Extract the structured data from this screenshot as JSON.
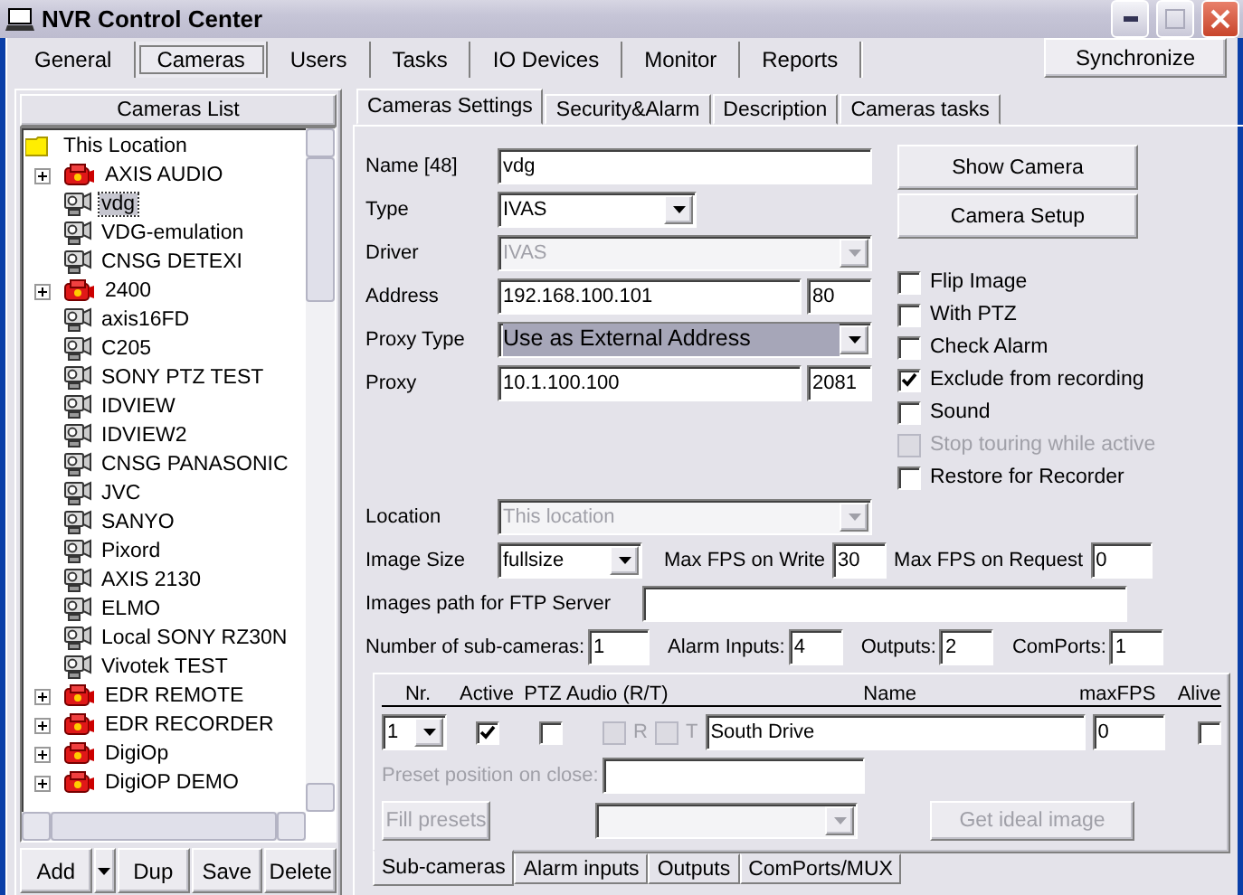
{
  "window": {
    "title": "NVR Control Center"
  },
  "main_tabs": [
    {
      "label": "General",
      "selected": false
    },
    {
      "label": "Cameras",
      "selected": true
    },
    {
      "label": "Users",
      "selected": false
    },
    {
      "label": "Tasks",
      "selected": false
    },
    {
      "label": "IO Devices",
      "selected": false
    },
    {
      "label": "Monitor",
      "selected": false
    },
    {
      "label": "Reports",
      "selected": false
    }
  ],
  "sync_button": "Synchronize",
  "cameras_list": {
    "title": "Cameras List",
    "root": {
      "label": "This Location",
      "selected": false,
      "children": [
        {
          "label": "AXIS AUDIO",
          "kind": "group",
          "selected": false
        },
        {
          "label": "vdg",
          "kind": "camera",
          "selected": true
        },
        {
          "label": "VDG-emulation",
          "kind": "camera",
          "selected": false
        },
        {
          "label": "CNSG DETEXI",
          "kind": "camera",
          "selected": false
        },
        {
          "label": "2400",
          "kind": "group",
          "selected": false
        },
        {
          "label": "axis16FD",
          "kind": "camera",
          "selected": false
        },
        {
          "label": "C205",
          "kind": "camera",
          "selected": false
        },
        {
          "label": "SONY PTZ TEST",
          "kind": "camera",
          "selected": false
        },
        {
          "label": "IDVIEW",
          "kind": "camera",
          "selected": false
        },
        {
          "label": "IDVIEW2",
          "kind": "camera",
          "selected": false
        },
        {
          "label": "CNSG PANASONIC",
          "kind": "camera",
          "selected": false
        },
        {
          "label": "JVC",
          "kind": "camera",
          "selected": false
        },
        {
          "label": "SANYO",
          "kind": "camera",
          "selected": false
        },
        {
          "label": "Pixord",
          "kind": "camera",
          "selected": false
        },
        {
          "label": "AXIS 2130",
          "kind": "camera",
          "selected": false
        },
        {
          "label": "ELMO",
          "kind": "camera",
          "selected": false
        },
        {
          "label": "Local SONY RZ30N",
          "kind": "camera",
          "selected": false
        },
        {
          "label": "Vivotek TEST",
          "kind": "camera",
          "selected": false
        },
        {
          "label": "EDR REMOTE",
          "kind": "group",
          "selected": false
        },
        {
          "label": "EDR RECORDER",
          "kind": "group",
          "selected": false
        },
        {
          "label": "DigiOp",
          "kind": "group",
          "selected": false
        },
        {
          "label": "DigiOP DEMO",
          "kind": "group",
          "selected": false
        }
      ]
    }
  },
  "list_buttons": [
    {
      "label": "Add",
      "kind": "split"
    },
    {
      "label": "Dup",
      "kind": "plain"
    },
    {
      "label": "Save",
      "kind": "plain"
    },
    {
      "label": "Delete",
      "kind": "plain"
    }
  ],
  "settings_tabs": [
    {
      "label": "Cameras Settings",
      "selected": true
    },
    {
      "label": "Security&Alarm",
      "selected": false
    },
    {
      "label": "Description",
      "selected": false
    },
    {
      "label": "Cameras tasks",
      "selected": false
    }
  ],
  "fields": [
    {
      "label": "Name [48]",
      "kind": "text",
      "value": "vdg",
      "disabled": false
    },
    {
      "label": "Type",
      "kind": "short_select",
      "value": "IVAS",
      "disabled": false,
      "highlighted": false
    },
    {
      "label": "Driver",
      "kind": "select",
      "value": "IVAS",
      "disabled": true,
      "highlighted": false
    },
    {
      "label": "Address",
      "kind": "text",
      "value": "192.168.100.101",
      "port": "80",
      "disabled": false
    },
    {
      "label": "Proxy Type",
      "kind": "select",
      "value": "Use as External Address",
      "disabled": false,
      "highlighted": true
    },
    {
      "label": "Proxy",
      "kind": "text",
      "value": "10.1.100.100",
      "port": "2081",
      "disabled": false
    }
  ],
  "camera_buttons": [
    "Show Camera",
    "Camera Setup"
  ],
  "options": [
    {
      "label": "Flip Image",
      "checked": false,
      "disabled": false
    },
    {
      "label": "With PTZ",
      "checked": false,
      "disabled": false
    },
    {
      "label": "Check Alarm",
      "checked": false,
      "disabled": false
    },
    {
      "label": "Exclude from recording",
      "checked": true,
      "disabled": false
    },
    {
      "label": "Sound",
      "checked": false,
      "disabled": false
    },
    {
      "label": "Stop touring while active",
      "checked": false,
      "disabled": true
    },
    {
      "label": "Restore for Recorder",
      "checked": false,
      "disabled": false
    }
  ],
  "location": {
    "label": "Location",
    "value": "This location",
    "disabled": true
  },
  "image_size": {
    "label": "Image Size",
    "value": "fullsize"
  },
  "max_fps_write": {
    "label": "Max FPS on Write",
    "value": "30"
  },
  "max_fps_request": {
    "label": "Max FPS on Request",
    "value": "0"
  },
  "images_path": {
    "label": "Images path for FTP Server"
  },
  "counts": [
    {
      "label": "Number of sub-cameras:",
      "value": "1"
    },
    {
      "label": "Alarm Inputs:",
      "value": "4"
    },
    {
      "label": "Outputs:",
      "value": "2"
    },
    {
      "label": "ComPorts:",
      "value": "1"
    }
  ],
  "subcameras": {
    "columns": [
      "Nr.",
      "Active",
      "PTZ",
      "Audio (R/T)",
      "Name",
      "maxFPS",
      "Alive"
    ],
    "row": {
      "nr": "1",
      "active": true,
      "ptz": false,
      "audio": [
        {
          "label": "R",
          "checked": false,
          "disabled": true
        },
        {
          "label": "T",
          "checked": false,
          "disabled": true
        }
      ],
      "name": "South Drive",
      "max_fps": "0",
      "alive": false
    },
    "preset": {
      "label": "Preset position on close:",
      "disabled": true
    },
    "fill_presets": {
      "label": "Fill presets",
      "disabled": true
    },
    "ideal_image": {
      "label": "Get ideal image",
      "disabled": true
    },
    "tabs": [
      {
        "label": "Sub-cameras",
        "selected": true
      },
      {
        "label": "Alarm inputs",
        "selected": false
      },
      {
        "label": "Outputs",
        "selected": false
      },
      {
        "label": "ComPorts/MUX",
        "selected": false
      }
    ]
  }
}
